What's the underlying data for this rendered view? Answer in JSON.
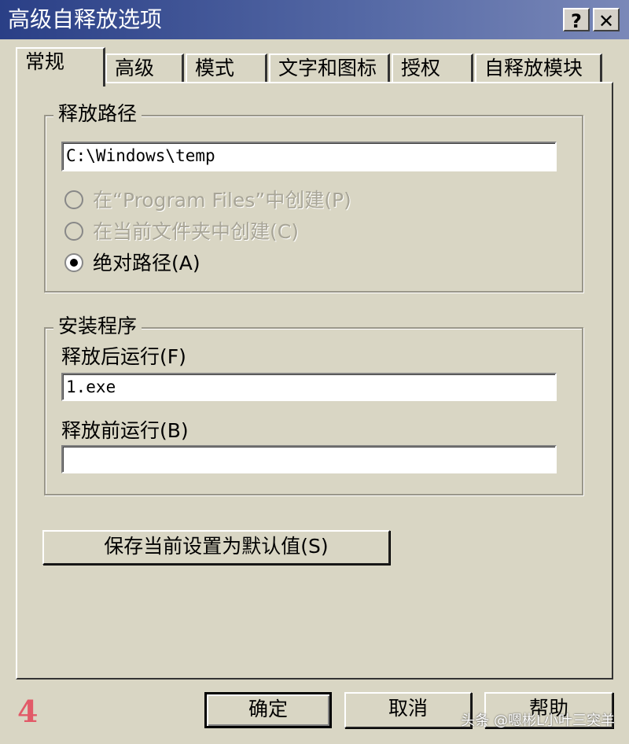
{
  "window": {
    "title": "高级自释放选项",
    "help_button": "?",
    "close_button": "✕"
  },
  "tabs": [
    {
      "label": "常规",
      "active": true
    },
    {
      "label": "高级"
    },
    {
      "label": "模式"
    },
    {
      "label": "文字和图标"
    },
    {
      "label": "授权"
    },
    {
      "label": "自释放模块"
    }
  ],
  "release_path": {
    "legend": "释放路径",
    "path_value": "C:\\Windows\\temp",
    "options": [
      {
        "label": "在“Program Files”中创建(P)",
        "enabled": false,
        "selected": false
      },
      {
        "label": "在当前文件夹中创建(C)",
        "enabled": false,
        "selected": false
      },
      {
        "label": "绝对路径(A)",
        "enabled": true,
        "selected": true
      }
    ]
  },
  "installer": {
    "legend": "安装程序",
    "run_after_label": "释放后运行(F)",
    "run_after_value": "1.exe",
    "run_before_label": "释放前运行(B)",
    "run_before_value": ""
  },
  "save_default_button": "保存当前设置为默认值(S)",
  "footer": {
    "ok_button": "确定",
    "cancel_button": "取消",
    "help_button": "帮助"
  },
  "figure_number": "4",
  "watermark": "头条 @嗯彬L小叶三突羊"
}
